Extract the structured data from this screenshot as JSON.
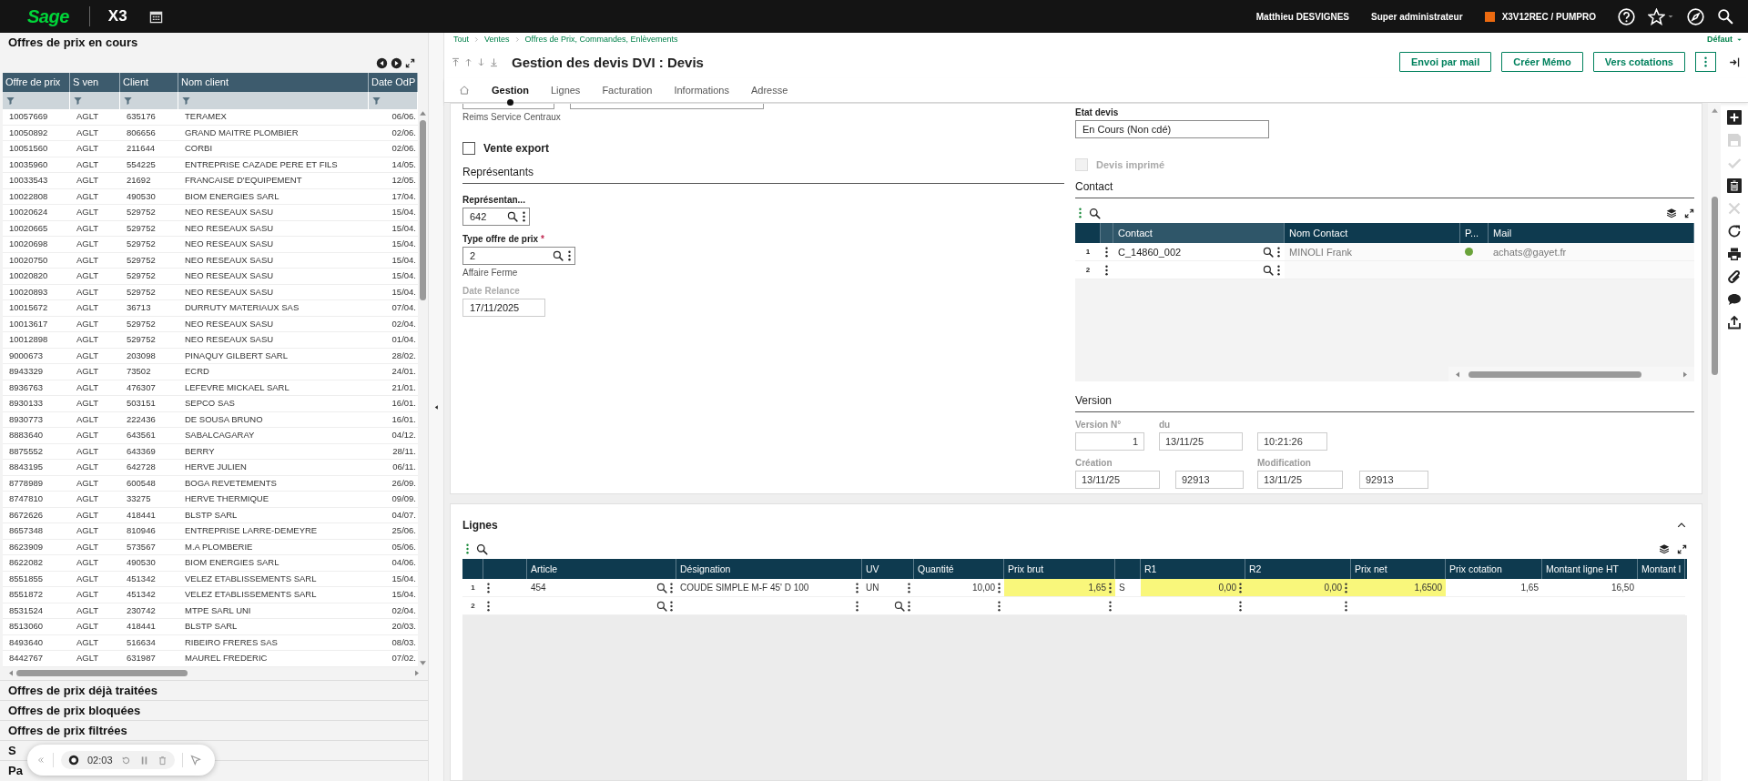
{
  "top_bar": {
    "logo": "Sage",
    "product": "X3",
    "user": "Matthieu DESVIGNES",
    "role": "Super administrateur",
    "environment": "X3V12REC / PUMPRO"
  },
  "left_panel": {
    "sections": [
      {
        "title": "Offres de prix en cours",
        "expanded": true
      },
      {
        "title": "Offres de prix déjà traitées",
        "expanded": false
      },
      {
        "title": "Offres de prix bloquées",
        "expanded": false
      },
      {
        "title": "Offres de prix filtrées",
        "expanded": false
      },
      {
        "title": "S",
        "expanded": false
      },
      {
        "title": "Pa",
        "expanded": false
      }
    ],
    "table": {
      "columns": [
        "Offre de prix",
        "S ven",
        "Client",
        "Nom client",
        "Date OdP"
      ],
      "rows": [
        [
          "10057669",
          "AGLT",
          "635176",
          "TERAMEX",
          "06/06."
        ],
        [
          "10050892",
          "AGLT",
          "806656",
          "GRAND MAITRE PLOMBIER",
          "02/06."
        ],
        [
          "10051560",
          "AGLT",
          "211644",
          "CORBI",
          "02/06."
        ],
        [
          "10035960",
          "AGLT",
          "554225",
          "ENTREPRISE CAZADE PERE ET FILS",
          "14/05."
        ],
        [
          "10033543",
          "AGLT",
          "21692",
          "FRANCAISE D'EQUIPEMENT",
          "12/05."
        ],
        [
          "10022808",
          "AGLT",
          "490530",
          "BIOM ENERGIES SARL",
          "17/04."
        ],
        [
          "10020624",
          "AGLT",
          "529752",
          "NEO RESEAUX SASU",
          "15/04."
        ],
        [
          "10020665",
          "AGLT",
          "529752",
          "NEO RESEAUX SASU",
          "15/04."
        ],
        [
          "10020698",
          "AGLT",
          "529752",
          "NEO RESEAUX SASU",
          "15/04."
        ],
        [
          "10020750",
          "AGLT",
          "529752",
          "NEO RESEAUX SASU",
          "15/04."
        ],
        [
          "10020820",
          "AGLT",
          "529752",
          "NEO RESEAUX SASU",
          "15/04."
        ],
        [
          "10020893",
          "AGLT",
          "529752",
          "NEO RESEAUX SASU",
          "15/04."
        ],
        [
          "10015672",
          "AGLT",
          "36713",
          "DURRUTY MATERIAUX SAS",
          "07/04."
        ],
        [
          "10013617",
          "AGLT",
          "529752",
          "NEO RESEAUX SASU",
          "02/04."
        ],
        [
          "10012898",
          "AGLT",
          "529752",
          "NEO RESEAUX SASU",
          "01/04."
        ],
        [
          "9000673",
          "AGLT",
          "203098",
          "PINAQUY GILBERT SARL",
          "28/02."
        ],
        [
          "8943329",
          "AGLT",
          "73502",
          "ECRD",
          "24/01."
        ],
        [
          "8936763",
          "AGLT",
          "476307",
          "LEFEVRE MICKAEL SARL",
          "21/01."
        ],
        [
          "8930133",
          "AGLT",
          "503151",
          "SEPCO SAS",
          "16/01."
        ],
        [
          "8930773",
          "AGLT",
          "222436",
          "DE SOUSA BRUNO",
          "16/01."
        ],
        [
          "8883640",
          "AGLT",
          "643561",
          "SABALCAGARAY",
          "04/12."
        ],
        [
          "8875552",
          "AGLT",
          "643369",
          "BERRY",
          "28/11."
        ],
        [
          "8843195",
          "AGLT",
          "642728",
          "HERVE JULIEN",
          "06/11."
        ],
        [
          "8778989",
          "AGLT",
          "600548",
          "BOGA REVETEMENTS",
          "26/09."
        ],
        [
          "8747810",
          "AGLT",
          "33275",
          "HERVE THERMIQUE",
          "09/09."
        ],
        [
          "8672626",
          "AGLT",
          "418441",
          "BLSTP SARL",
          "04/07."
        ],
        [
          "8657348",
          "AGLT",
          "810946",
          "ENTREPRISE LARRE-DEMEYRE",
          "25/06."
        ],
        [
          "8623909",
          "AGLT",
          "573567",
          "M.A PLOMBERIE",
          "05/06."
        ],
        [
          "8622082",
          "AGLT",
          "490530",
          "BIOM ENERGIES SARL",
          "04/06."
        ],
        [
          "8551855",
          "AGLT",
          "451342",
          "VELEZ ETABLISSEMENTS SARL",
          "15/04."
        ],
        [
          "8551872",
          "AGLT",
          "451342",
          "VELEZ ETABLISSEMENTS SARL",
          "15/04."
        ],
        [
          "8531524",
          "AGLT",
          "230742",
          "MTPE SARL UNI",
          "02/04."
        ],
        [
          "8513060",
          "AGLT",
          "418441",
          "BLSTP SARL",
          "20/03."
        ],
        [
          "8493640",
          "AGLT",
          "516634",
          "RIBEIRO FRERES SAS",
          "08/03."
        ],
        [
          "8442767",
          "AGLT",
          "631987",
          "MAUREL FREDERIC",
          "07/02."
        ]
      ]
    }
  },
  "breadcrumb": [
    "Tout",
    "Ventes",
    "Offres de Prix, Commandes, Enlèvements"
  ],
  "view_selector": "Défaut",
  "page_title": "Gestion des devis DVI : Devis",
  "actions": [
    "Envoi par mail",
    "Créer Mémo",
    "Vers cotations"
  ],
  "tabs": [
    {
      "label": "Gestion",
      "selected": true
    },
    {
      "label": "Lignes",
      "selected": false
    },
    {
      "label": "Facturation",
      "selected": false
    },
    {
      "label": "Informations",
      "selected": false
    },
    {
      "label": "Adresse",
      "selected": false
    }
  ],
  "form": {
    "site_caption": "Reims Service Centraux",
    "export_sale": {
      "label": "Vente export",
      "checked": false
    },
    "representatives": {
      "title": "Représentants",
      "rep_label": "Représentan...",
      "rep_value": "642",
      "type_label": "Type offre de prix",
      "type_required_mark": "*",
      "type_value": "2",
      "type_caption": "Affaire Ferme",
      "reminder_label": "Date Relance",
      "reminder_disabled": true,
      "reminder_value": "17/11/2025"
    },
    "status_label": "Etat devis",
    "status_value": "En Cours (Non cdé)",
    "printed": {
      "label": "Devis imprimé",
      "checked": false,
      "disabled": true
    },
    "contact": {
      "title": "Contact",
      "columns": [
        "Contact",
        "Nom Contact",
        "P...",
        "Mail"
      ],
      "rows": [
        {
          "number": "1",
          "contact": "C_14860_002",
          "name": "MINOLI Frank",
          "color": "#6aa33a",
          "mail": "achats@gayet.fr"
        },
        {
          "number": "2"
        }
      ]
    },
    "version": {
      "title": "Version",
      "number_label": "Version N°",
      "number": "1",
      "date_label": "du",
      "date": "13/11/25",
      "time": "10:21:26",
      "created_label": "Création",
      "created_date": "13/11/25",
      "created_by": "92913",
      "modified_label": "Modification",
      "modified_date": "13/11/25",
      "modified_by": "92913"
    }
  },
  "lines": {
    "title": "Lignes",
    "columns": [
      {
        "label": "Article"
      },
      {
        "label": "Désignation"
      },
      {
        "label": "UV"
      },
      {
        "label": "Quantité"
      },
      {
        "label": "Prix brut"
      },
      {},
      {
        "label": "R1"
      },
      {
        "label": "R2"
      },
      {
        "label": "Prix net"
      },
      {
        "label": "Prix cotation"
      },
      {
        "label": "Montant ligne HT"
      },
      {
        "label": "Montant l"
      }
    ],
    "rows": [
      {
        "number": "1",
        "cells": [
          {
            "text": "454",
            "highlighted": false,
            "lookup": true,
            "menu": true
          },
          {
            "text": "COUDE SIMPLE M-F 45' D 100",
            "highlighted": false,
            "lookup": false,
            "menu": true
          },
          {
            "text": "UN",
            "highlighted": false,
            "lookup": false,
            "menu": true
          },
          {
            "text": "10,00",
            "highlighted": false,
            "lookup": false,
            "menu": true
          },
          {
            "text": "1,65",
            "highlighted": true,
            "lookup": false,
            "menu": true
          },
          {
            "text": "S",
            "highlighted": false,
            "lookup": false,
            "menu": false
          },
          {
            "text": "0,00",
            "highlighted": true,
            "lookup": false,
            "menu": true
          },
          {
            "text": "0,00",
            "highlighted": true,
            "lookup": false,
            "menu": true
          },
          {
            "text": "1,6500",
            "highlighted": true,
            "lookup": false,
            "menu": false
          },
          {
            "text": "1,65",
            "highlighted": false,
            "lookup": false,
            "menu": false
          },
          {
            "text": "16,50",
            "highlighted": false,
            "lookup": false,
            "menu": false
          },
          {
            "highlighted": false,
            "lookup": false,
            "menu": false
          }
        ]
      },
      {
        "number": "2",
        "cells": [
          {
            "highlighted": false,
            "lookup": true,
            "menu": true
          },
          {
            "highlighted": false,
            "lookup": false,
            "menu": true
          },
          {
            "highlighted": false,
            "lookup": true,
            "menu": true
          },
          {
            "highlighted": false,
            "lookup": false,
            "menu": true
          },
          {
            "highlighted": false,
            "lookup": false,
            "menu": true
          },
          {
            "highlighted": false,
            "lookup": false,
            "menu": false
          },
          {
            "highlighted": false,
            "lookup": false,
            "menu": true
          },
          {
            "highlighted": false,
            "lookup": false,
            "menu": true
          },
          {
            "highlighted": false,
            "lookup": false,
            "menu": false
          },
          {
            "highlighted": false,
            "lookup": false,
            "menu": false
          },
          {
            "highlighted": false,
            "lookup": false,
            "menu": false
          },
          {
            "highlighted": false,
            "lookup": false,
            "menu": false
          }
        ]
      }
    ]
  },
  "right_toolbar": [
    {
      "kind": "add",
      "disabled": false
    },
    {
      "kind": "save",
      "disabled": true
    },
    {
      "kind": "validate",
      "disabled": true
    },
    {
      "kind": "delete",
      "disabled": false
    },
    {
      "kind": "cancel",
      "disabled": true
    },
    {
      "kind": "refresh",
      "disabled": false
    },
    {
      "kind": "print",
      "disabled": false
    },
    {
      "kind": "attach",
      "disabled": false
    },
    {
      "kind": "comment",
      "disabled": false
    },
    {
      "kind": "share",
      "disabled": false
    }
  ],
  "recorder": {
    "time": "02:03"
  }
}
